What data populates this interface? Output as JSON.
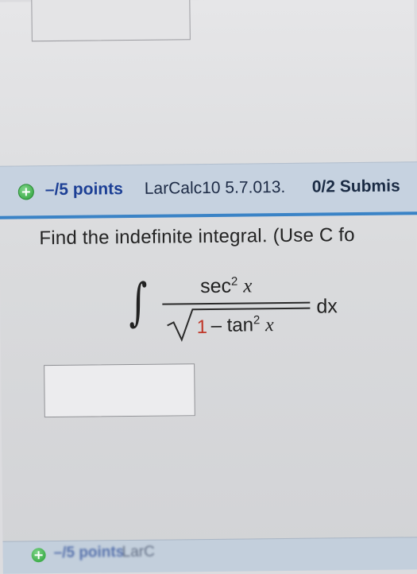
{
  "question": {
    "points": "–/5 points",
    "problem_id": "LarCalc10 5.7.013.",
    "submissions": "0/2 Submis",
    "prompt": "Find the indefinite integral. (Use C fo",
    "integral": {
      "sign": "∫",
      "numerator_func": "sec",
      "numerator_exp": "2",
      "numerator_var": "x",
      "denominator_one": "1",
      "denominator_rest": " – tan",
      "denominator_exp": "2",
      "denominator_var": "x",
      "differential": "dx"
    },
    "answer_value": ""
  },
  "next_question": {
    "points": "–/5 points",
    "problem_id": "LarC"
  },
  "colors": {
    "header_bg": "#c6d2e0",
    "header_accent": "#3a83c6",
    "points_text": "#1c3f95",
    "plus_icon": "#3fae4b",
    "highlight_one": "#c0392b"
  }
}
